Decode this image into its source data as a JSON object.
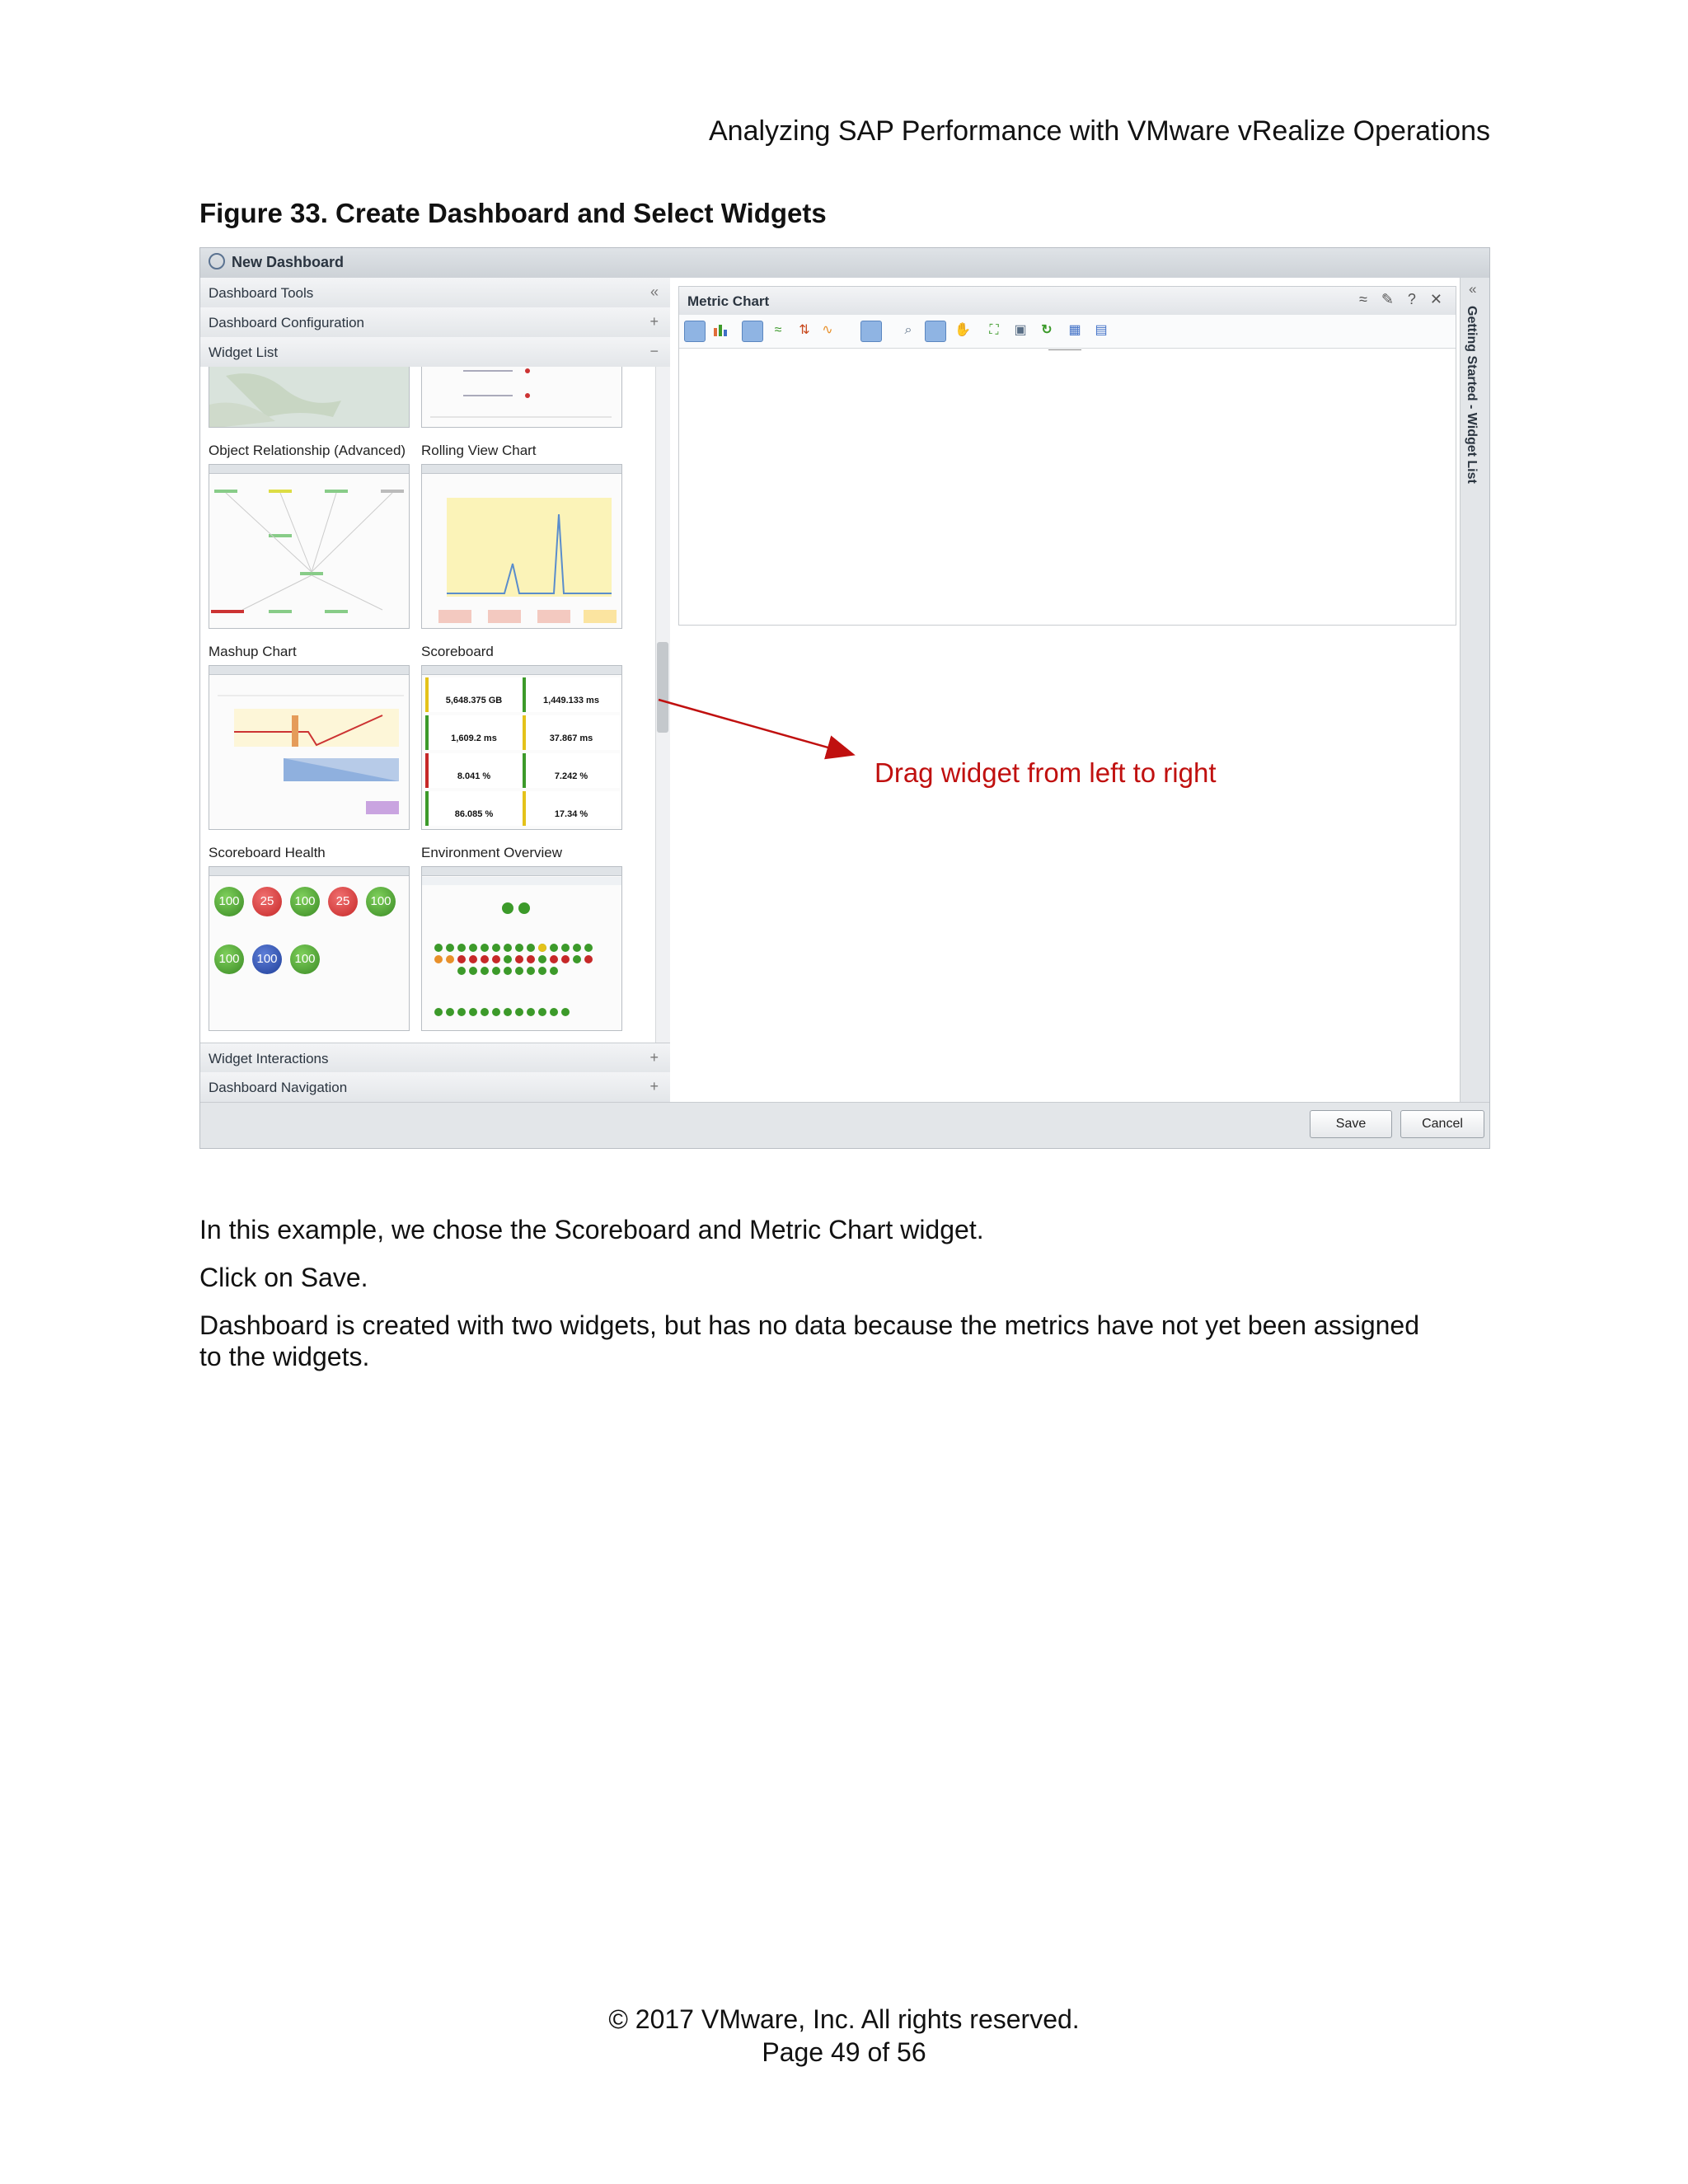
{
  "header": {
    "doc_title": "Analyzing SAP Performance with VMware vRealize Operations"
  },
  "figure": {
    "caption": "Figure 33. Create Dashboard and Select Widgets"
  },
  "app": {
    "window_title": "New Dashboard",
    "left_panel": {
      "sections": [
        {
          "label": "Dashboard Tools",
          "symbol": "«"
        },
        {
          "label": "Dashboard Configuration",
          "symbol": "+"
        },
        {
          "label": "Widget List",
          "symbol": "−"
        }
      ],
      "widgets": [
        {
          "label": "Object Relationship (Advanced)"
        },
        {
          "label": "Rolling View Chart"
        },
        {
          "label": "Mashup Chart"
        },
        {
          "label": "Scoreboard"
        },
        {
          "label": "Scoreboard Health"
        },
        {
          "label": "Environment Overview"
        }
      ],
      "bottom_sections": [
        {
          "label": "Widget Interactions",
          "symbol": "+"
        },
        {
          "label": "Dashboard Navigation",
          "symbol": "+"
        }
      ],
      "scoreboard_values": [
        "5,648.375 GB",
        "1,449.133 ms",
        "1,609.2 ms",
        "37.867 ms",
        "8.041 %",
        "7.242 %",
        "86.085 %",
        "17.34 %"
      ],
      "health_badges": [
        "100",
        "25",
        "100",
        "25",
        "100",
        "100",
        "100",
        "100"
      ]
    },
    "metric_chart": {
      "title": "Metric Chart",
      "controls": "≈ ✎ ? ✕"
    },
    "right_strip": {
      "label": "Getting Started - Widget List",
      "collapse": "«"
    },
    "buttons": {
      "save": "Save",
      "cancel": "Cancel"
    },
    "annotation": "Drag widget from left to right"
  },
  "body": {
    "p1": "In this example, we chose the Scoreboard and Metric Chart widget.",
    "p2": "Click on Save.",
    "p3_line1": "Dashboard is created with two widgets, but has no data because the metrics have not yet been assigned",
    "p3_line2": "to the widgets."
  },
  "footer": {
    "copyright": "© 2017 VMware, Inc. All rights reserved.",
    "page": "Page 49 of 56"
  },
  "colors": {
    "annotation_red": "#c0100f",
    "health_green": "#3a8a24",
    "health_red": "#c62828",
    "health_blue": "#1f3f9a"
  }
}
